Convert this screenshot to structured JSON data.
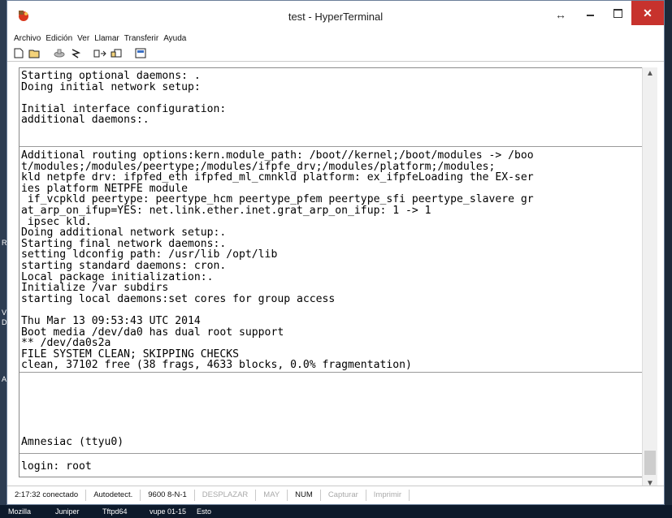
{
  "desktop": {
    "edge_letters": [
      "R",
      "V",
      "De",
      "A"
    ]
  },
  "window": {
    "title": "test - HyperTerminal",
    "icon": "hyperterminal-app-icon",
    "controls": {
      "arrows": "↔",
      "minimize": "minimize-icon",
      "maximize": "maximize-icon",
      "close": "✕"
    }
  },
  "menu": {
    "items": [
      "Archivo",
      "Edición",
      "Ver",
      "Llamar",
      "Transferir",
      "Ayuda"
    ]
  },
  "toolbar": {
    "icons": [
      "new-icon",
      "open-icon",
      "connect-icon",
      "disconnect-icon",
      "send-icon",
      "receive-icon",
      "properties-icon"
    ]
  },
  "terminal": {
    "block1": [
      "Starting optional daemons: .",
      "Doing initial network setup:",
      "",
      "Initial interface configuration:",
      "additional daemons:."
    ],
    "block2": [
      "Additional routing options:kern.module_path: /boot//kernel;/boot/modules -> /boo",
      "t/modules;/modules/peertype;/modules/ifpfe_drv;/modules/platform;/modules;",
      "kld netpfe drv: ifpfed_eth ifpfed_ml_cmnkld platform: ex_ifpfeLoading the EX-ser",
      "ies platform NETPFE module",
      " if_vcpkld peertype: peertype_hcm peertype_pfem peertype_sfi peertype_slavere gr",
      "at_arp_on_ifup=YES: net.link.ether.inet.grat_arp_on_ifup: 1 -> 1",
      " ipsec kld.",
      "Doing additional network setup:.",
      "Starting final network daemons:.",
      "setting ldconfig path: /usr/lib /opt/lib",
      "starting standard daemons: cron.",
      "Local package initialization:.",
      "Initialize /var subdirs",
      "starting local daemons:set cores for group access",
      "",
      "Thu Mar 13 09:53:43 UTC 2014",
      "Boot media /dev/da0 has dual root support",
      "** /dev/da0s2a",
      "FILE SYSTEM CLEAN; SKIPPING CHECKS",
      "clean, 37102 free (38 frags, 4633 blocks, 0.0% fragmentation)"
    ],
    "block3": [
      "Amnesiac (ttyu0)"
    ],
    "block4": [
      "login: root"
    ]
  },
  "status": {
    "connected": "2:17:32 conectado",
    "detect": "Autodetect.",
    "params": "9600 8-N-1",
    "scroll": "DESPLAZAR",
    "caps": "MAY",
    "num": "NUM",
    "capture": "Capturar",
    "print": "Imprimir"
  },
  "taskbar": {
    "items": [
      "Mozilla",
      "Juniper",
      "Tftpd64",
      "vupe 01-15",
      "Esto"
    ]
  }
}
